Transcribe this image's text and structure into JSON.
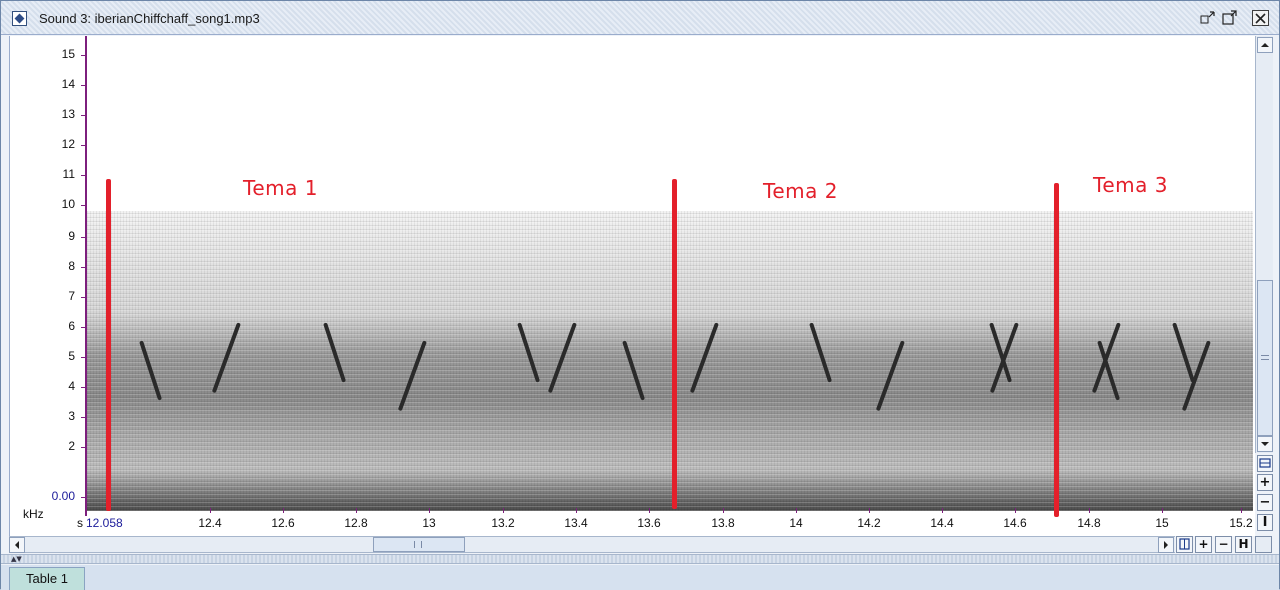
{
  "window": {
    "title": "Sound 3: iberianChiffchaff_song1.mp3",
    "controls": {
      "minimize": "▫ʼ",
      "maximize": "◻ʼ",
      "close": "✕"
    }
  },
  "spectrogram": {
    "y_unit": "kHz",
    "y_ticks": [
      "15",
      "14",
      "13",
      "12",
      "11",
      "10",
      "9",
      "8",
      "7",
      "6",
      "5",
      "4",
      "3",
      "2",
      "0.00"
    ],
    "x_unit": "s",
    "x_start": "12.058",
    "x_ticks": [
      "12.4",
      "12.6",
      "12.8",
      "13",
      "13.2",
      "13.4",
      "13.6",
      "13.8",
      "14",
      "14.2",
      "14.4",
      "14.6",
      "14.8",
      "15",
      "15.2"
    ],
    "annotations": [
      {
        "label": "Tema 1"
      },
      {
        "label": "Tema 2"
      },
      {
        "label": "Tema 3"
      }
    ],
    "marker_color": "#e3202b"
  },
  "zoom_controls": {
    "vertical": {
      "zoom_in": "+",
      "zoom_out": "−",
      "fit": "I"
    },
    "horizontal": {
      "zoom_in": "+",
      "zoom_out": "−",
      "fit": "H"
    }
  },
  "split_pane": {
    "arrows": "▲▼"
  },
  "tabs": [
    {
      "label": "Table 1"
    }
  ]
}
